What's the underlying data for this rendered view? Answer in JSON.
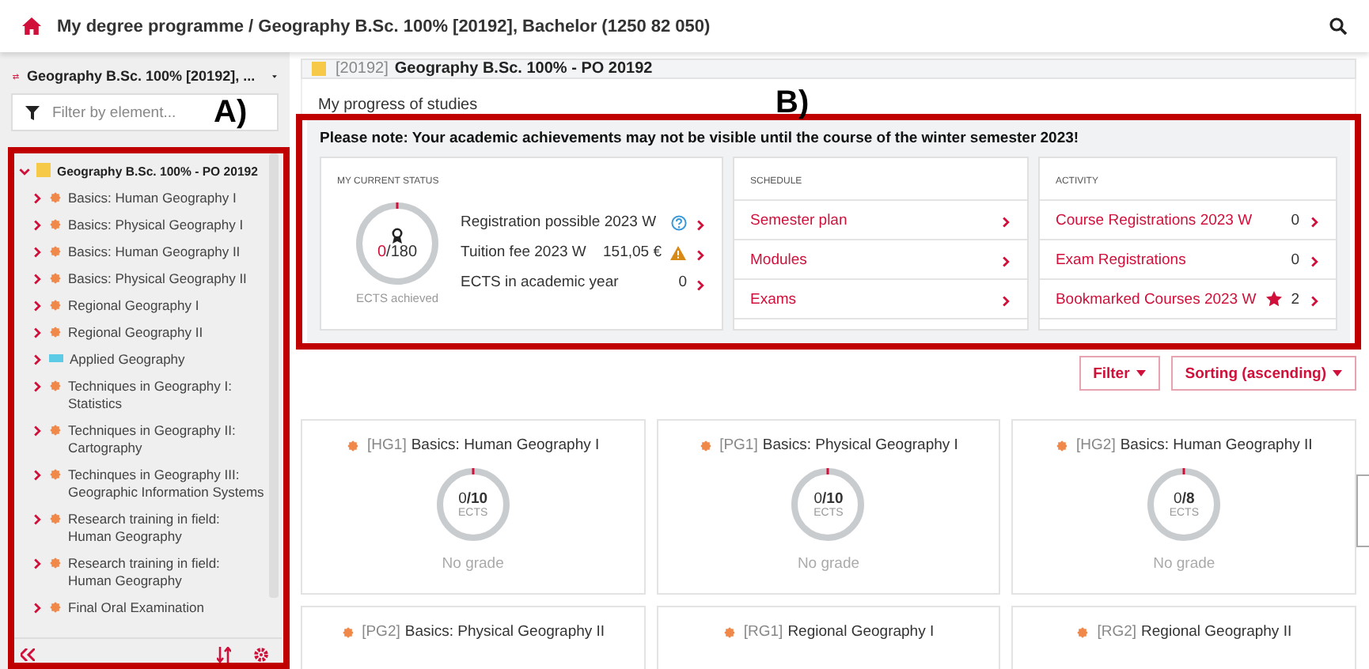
{
  "breadcrumb": "My degree programme / Geography B.Sc. 100% [20192], Bachelor (1250 82 050)",
  "annotations": [
    {
      "label": "A)"
    },
    {
      "label": "B)"
    }
  ],
  "sidebar": {
    "programme": "Geography B.Sc. 100% [20192], ...",
    "filter": {
      "placeholder": "Filter by element..."
    },
    "tree": {
      "label": "Geography B.Sc. 100% - PO 20192",
      "color": "#f7c948",
      "expanded": true,
      "children": [
        {
          "label": "Basics: Human Geography I",
          "kind": "module",
          "color": "#f0884a",
          "expanded": false
        },
        {
          "label": "Basics: Physical Geography I",
          "kind": "module",
          "color": "#f0884a",
          "expanded": false
        },
        {
          "label": "Basics: Human Geography II",
          "kind": "module",
          "color": "#f0884a",
          "expanded": false
        },
        {
          "label": "Basics: Physical Geography II",
          "kind": "module",
          "color": "#f0884a",
          "expanded": false
        },
        {
          "label": "Regional Geography I",
          "kind": "module",
          "color": "#f0884a",
          "expanded": false
        },
        {
          "label": "Regional Geography II",
          "kind": "module",
          "color": "#f0884a",
          "expanded": false
        },
        {
          "label": "Applied Geography",
          "kind": "area",
          "color": "#5ccbe6",
          "expanded": false
        },
        {
          "label": "Techniques in Geography I: Statistics",
          "kind": "module",
          "color": "#f0884a",
          "expanded": false
        },
        {
          "label": "Techniques in Geography II: Cartography",
          "kind": "module",
          "color": "#f0884a",
          "expanded": false
        },
        {
          "label": "Techinques in Geography III: Geographic Information Systems",
          "kind": "module",
          "color": "#f0884a",
          "expanded": false
        },
        {
          "label": "Research training in field: Human Geography",
          "kind": "module",
          "color": "#f0884a",
          "expanded": false
        },
        {
          "label": "Research training in field: Human Geography",
          "kind": "module",
          "color": "#f0884a",
          "expanded": false
        },
        {
          "label": "Final Oral Examination",
          "kind": "module",
          "color": "#f0884a",
          "expanded": false
        }
      ]
    }
  },
  "programme_header": {
    "code": "[20192]",
    "title": "Geography B.Sc. 100% - PO 20192",
    "color": "#f7c948"
  },
  "progress_title": "My progress of studies",
  "notice": "Please note: Your academic achievements may not be visible until the course of the winter semester 2023!",
  "status": {
    "heading": "MY CURRENT STATUS",
    "ring": {
      "earned": "0",
      "total": "/180",
      "caption": "ECTS achieved"
    },
    "rows": [
      {
        "label": "Registration possible 2023 W",
        "kind": "help"
      },
      {
        "label": "Tuition fee 2023 W",
        "value": "151,05 €",
        "kind": "warning"
      },
      {
        "label": "ECTS in academic year",
        "value": "0",
        "kind": "plain"
      }
    ]
  },
  "schedule": {
    "heading": "SCHEDULE",
    "rows": [
      {
        "label": "Semester plan"
      },
      {
        "label": "Modules"
      },
      {
        "label": "Exams"
      }
    ]
  },
  "activity": {
    "heading": "ACTIVITY",
    "rows": [
      {
        "label": "Course Registrations 2023 W",
        "count": "0",
        "starred": false
      },
      {
        "label": "Exam Registrations",
        "count": "0",
        "starred": false
      },
      {
        "label": "Bookmarked Courses 2023 W",
        "count": "2",
        "starred": true
      }
    ]
  },
  "buttons": [
    "Filter",
    "Sorting (ascending)"
  ],
  "cards": [
    {
      "code": "[HG1]",
      "title": "Basics: Human Geography I",
      "color": "#f0884a",
      "earned": "0",
      "total": "/10",
      "unit": "ECTS",
      "grade": "No grade"
    },
    {
      "code": "[PG1]",
      "title": "Basics: Physical Geography I",
      "color": "#f0884a",
      "earned": "0",
      "total": "/10",
      "unit": "ECTS",
      "grade": "No grade"
    },
    {
      "code": "[HG2]",
      "title": "Basics: Human Geography II",
      "color": "#f0884a",
      "earned": "0",
      "total": "/8",
      "unit": "ECTS",
      "grade": "No grade"
    },
    {
      "code": "[PG2]",
      "title": "Basics: Physical Geography II",
      "color": "#f0884a"
    },
    {
      "code": "[RG1]",
      "title": "Regional Geography I",
      "color": "#f0884a"
    },
    {
      "code": "[RG2]",
      "title": "Regional Geography II",
      "color": "#f0884a"
    }
  ]
}
